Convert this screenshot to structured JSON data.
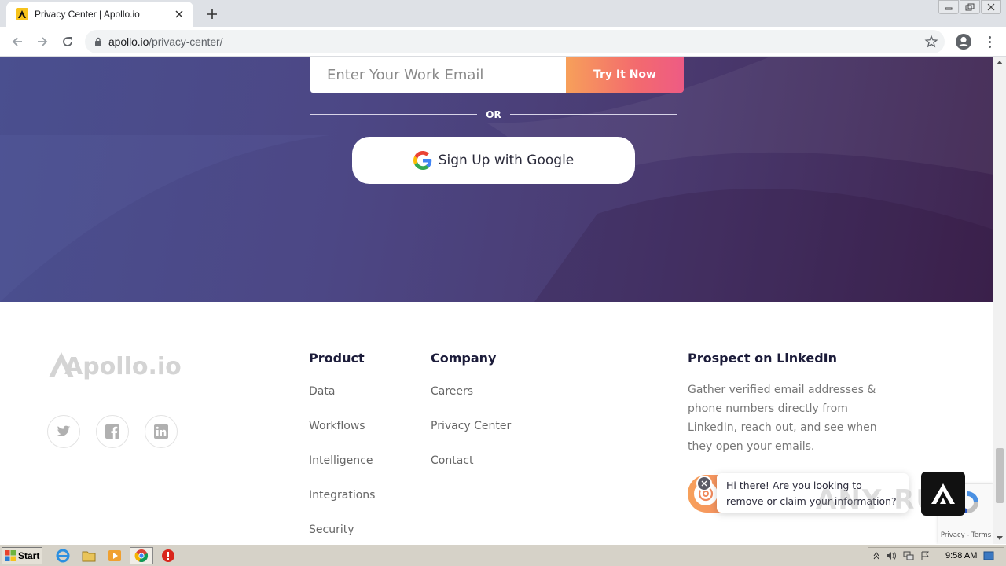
{
  "browser": {
    "tab_title": "Privacy Center | Apollo.io",
    "url_host": "apollo.io",
    "url_path": "/privacy-center/"
  },
  "hero": {
    "email_placeholder": "Enter Your Work Email",
    "try_button": "Try It Now",
    "or_text": "OR",
    "google_button": "Sign Up with Google"
  },
  "footer": {
    "logo_text": "Apollo.io",
    "social": [
      "twitter-icon",
      "facebook-icon",
      "linkedin-icon"
    ],
    "product": {
      "title": "Product",
      "links": [
        "Data",
        "Workflows",
        "Intelligence",
        "Integrations",
        "Security"
      ]
    },
    "company": {
      "title": "Company",
      "links": [
        "Careers",
        "Privacy Center",
        "Contact"
      ]
    },
    "linkedin": {
      "title": "Prospect on LinkedIn",
      "desc_lines": [
        "Gather verified email addresses &",
        "phone numbers directly from",
        "LinkedIn, reach out, and see when",
        "they open your emails."
      ]
    }
  },
  "chat": {
    "line1": "Hi there! Are you looking to",
    "line2": "remove or claim your information?"
  },
  "recaptcha": {
    "terms": "Privacy - Terms"
  },
  "watermark": "ANY RUN",
  "taskbar": {
    "start": "Start",
    "clock": "9:58 AM"
  },
  "colors": {
    "hero_start": "#4a4f8f",
    "hero_end": "#3f2550",
    "accent_orange": "#f7a05a",
    "accent_pink": "#ee5b84"
  }
}
